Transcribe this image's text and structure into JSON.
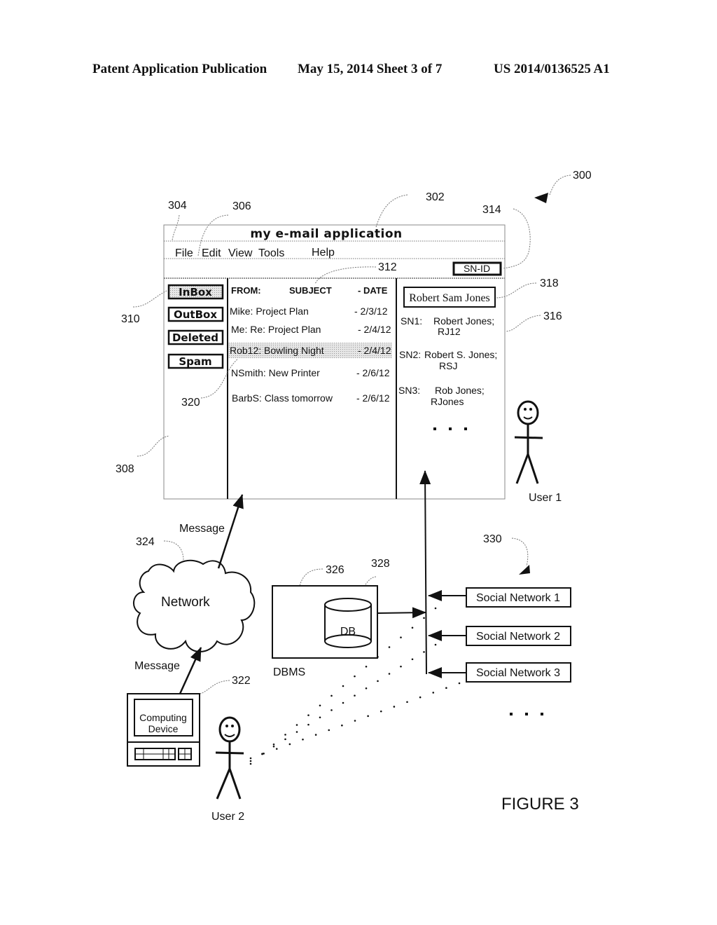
{
  "header": {
    "publication": "Patent Application Publication",
    "date_sheet": "May 15, 2014   Sheet 3 of 7",
    "number": "US 2014/0136525 A1"
  },
  "refs": {
    "r300": "300",
    "r302": "302",
    "r304": "304",
    "r306": "306",
    "r308": "308",
    "r310": "310",
    "r312": "312",
    "r314": "314",
    "r316": "316",
    "r318": "318",
    "r320": "320",
    "r322": "322",
    "r324": "324",
    "r326": "326",
    "r328": "328",
    "r330": "330"
  },
  "app": {
    "title": "my e-mail application",
    "menu": [
      "File",
      "Edit",
      "View",
      "Tools",
      "Help"
    ],
    "sn_id_button": "SN-ID",
    "folders": [
      "InBox",
      "OutBox",
      "Deleted",
      "Spam"
    ],
    "columns": {
      "from": "FROM:",
      "subject": "SUBJECT",
      "date": "- DATE"
    },
    "messages": [
      {
        "text": "Mike: Project Plan",
        "date": "- 2/3/12",
        "selected": false
      },
      {
        "text": "Me: Re: Project Plan",
        "date": "- 2/4/12",
        "selected": false
      },
      {
        "text": "Rob12: Bowling Night",
        "date": "- 2/4/12",
        "selected": true
      },
      {
        "text": "NSmith: New Printer",
        "date": "- 2/6/12",
        "selected": false
      },
      {
        "text": "BarbS: Class tomorrow",
        "date": "- 2/6/12",
        "selected": false
      }
    ],
    "contact_name": "Robert Sam Jones",
    "sn_entries": [
      {
        "label": "SN1:",
        "name": "Robert Jones;",
        "id": "RJ12"
      },
      {
        "label": "SN2:",
        "name": "Robert S. Jones;",
        "id": "RSJ"
      },
      {
        "label": "SN3:",
        "name": "Rob Jones;",
        "id": "RJones"
      }
    ],
    "ellipsis": ". . ."
  },
  "diagram": {
    "user1": "User 1",
    "user2": "User 2",
    "message_top": "Message",
    "message_bottom": "Message",
    "network": "Network",
    "db": "DB",
    "dbms": "DBMS",
    "computing_device": [
      "Computing",
      "Device"
    ],
    "social_networks": [
      "Social Network 1",
      "Social Network 2",
      "Social Network 3"
    ],
    "sn_ellipsis": ". . .",
    "figure": "FIGURE 3"
  }
}
